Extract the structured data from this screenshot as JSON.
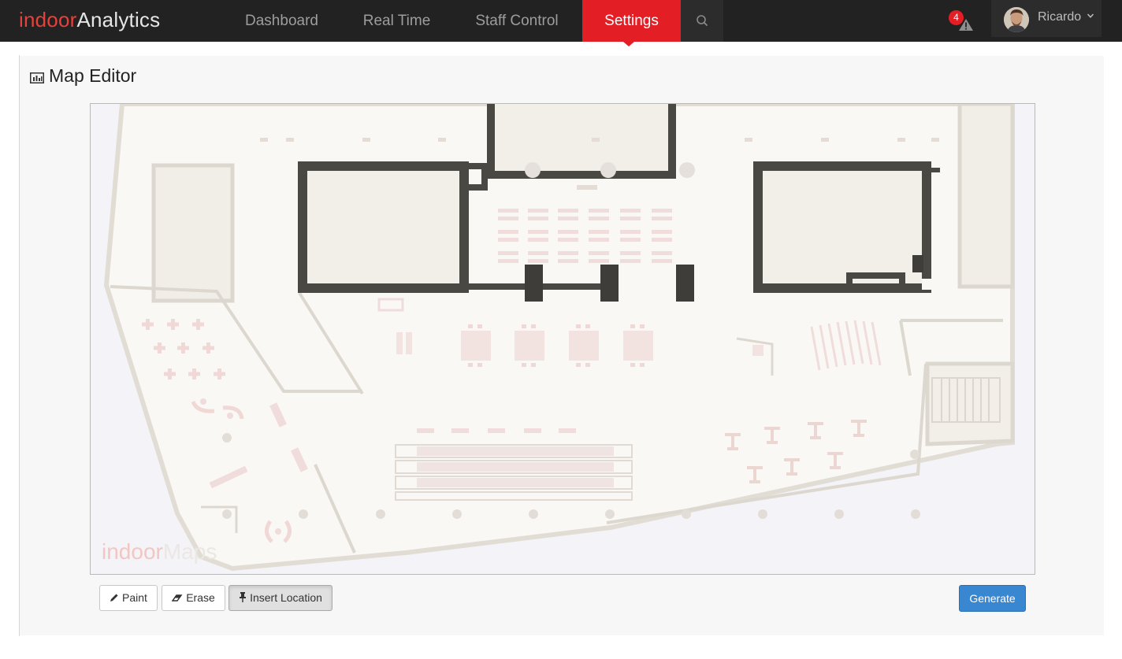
{
  "brand": {
    "part1": "indoor",
    "part2": "Analytics"
  },
  "nav": {
    "items": [
      {
        "label": "Dashboard"
      },
      {
        "label": "Real Time"
      },
      {
        "label": "Staff Control"
      },
      {
        "label": "Settings",
        "active": true
      }
    ],
    "search_icon": "search-icon"
  },
  "alerts": {
    "count": "4",
    "icon": "warning-icon"
  },
  "user": {
    "name": "Ricardo",
    "icon": "chevron-down-icon"
  },
  "panel": {
    "title": "Map Editor",
    "icon": "bar-chart-icon"
  },
  "map": {
    "watermark_part1": "indoor",
    "watermark_part2": "Maps"
  },
  "toolbar": {
    "paint_label": "Paint",
    "erase_label": "Erase",
    "insert_label": "Insert Location",
    "active_tool": "Insert Location",
    "generate_label": "Generate"
  },
  "colors": {
    "navbar": "#222222",
    "accent_red": "#e41e25",
    "brand_red": "#e8403a",
    "primary_blue": "#3a87d1",
    "wall_dark": "#4a4843"
  }
}
